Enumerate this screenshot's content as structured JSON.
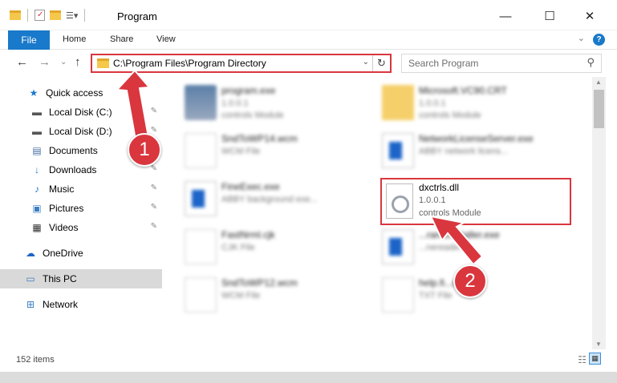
{
  "window": {
    "title": "Program",
    "minimize_glyph": "—",
    "maximize_glyph": "☐",
    "close_glyph": "✕"
  },
  "ribbon": {
    "file": "File",
    "home": "Home",
    "share": "Share",
    "view": "View",
    "help_glyph": "?",
    "collapse_glyph": "⌄"
  },
  "navigation": {
    "back_glyph": "←",
    "forward_glyph": "→",
    "recent_glyph": "⌄",
    "up_glyph": "↑",
    "address_path": "C:\\Program Files\\Program Directory",
    "address_dropdown_glyph": "⌄",
    "refresh_glyph": "↻",
    "search_placeholder": "Search Program",
    "search_glyph": "⚲"
  },
  "sidebar": {
    "items": [
      {
        "label": "Quick access",
        "icon": "star-icon",
        "glyph": "★",
        "color": "#1979ca",
        "pinned": false
      },
      {
        "label": "Local Disk (C:)",
        "icon": "drive-icon",
        "glyph": "▬",
        "color": "#555555",
        "pinned": true
      },
      {
        "label": "Local Disk (D:)",
        "icon": "drive-icon",
        "glyph": "▬",
        "color": "#555555",
        "pinned": true
      },
      {
        "label": "Documents",
        "icon": "documents-icon",
        "glyph": "▤",
        "color": "#4a6fa5",
        "pinned": true
      },
      {
        "label": "Downloads",
        "icon": "download-icon",
        "glyph": "↓",
        "color": "#1979ca",
        "pinned": true
      },
      {
        "label": "Music",
        "icon": "music-icon",
        "glyph": "♪",
        "color": "#1979ca",
        "pinned": true
      },
      {
        "label": "Pictures",
        "icon": "pictures-icon",
        "glyph": "▣",
        "color": "#3a7ec2",
        "pinned": true
      },
      {
        "label": "Videos",
        "icon": "videos-icon",
        "glyph": "▦",
        "color": "#333333",
        "pinned": true
      },
      {
        "label": "OneDrive",
        "icon": "cloud-icon",
        "glyph": "☁",
        "color": "#1c64c8",
        "pinned": false
      },
      {
        "label": "This PC",
        "icon": "computer-icon",
        "glyph": "▭",
        "color": "#3a7ec2",
        "pinned": false
      },
      {
        "label": "Network",
        "icon": "network-icon",
        "glyph": "⊞",
        "color": "#3a7ec2",
        "pinned": false
      }
    ],
    "pin_glyph": "📌"
  },
  "files": [
    {
      "name": "program.exe",
      "sub1": "1.0.0.1",
      "sub2": "controls Module",
      "thumb": "exe"
    },
    {
      "name": "Microsoft.VC90.CRT",
      "sub1": "1.0.0.1",
      "sub2": "controls Module",
      "thumb": "folder"
    },
    {
      "name": "SndToWP14.wcm",
      "sub1": "WCM File",
      "sub2": "",
      "thumb": "doc"
    },
    {
      "name": "NetworkLicenseServer.exe",
      "sub1": "ABBY network licens...",
      "sub2": "",
      "thumb": "app"
    },
    {
      "name": "FineExec.exe",
      "sub1": "ABBY background exe...",
      "sub2": "",
      "thumb": "app"
    },
    {
      "name": "FastNrml.cjk",
      "sub1": "CJK File",
      "sub2": "",
      "thumb": "doc"
    },
    {
      "name": "...ramsInstaller.exe",
      "sub1": "...nereader tri...",
      "sub2": "",
      "thumb": "app"
    },
    {
      "name": "SndToWP12.wcm",
      "sub1": "WCM File",
      "sub2": "",
      "thumb": "doc"
    },
    {
      "name": "help.fi...der.txt",
      "sub1": "TXT File",
      "sub2": "",
      "thumb": "doc"
    }
  ],
  "highlighted_file": {
    "name": "dxctrls.dll",
    "version": "1.0.0.1",
    "description": "controls Module"
  },
  "status": {
    "item_count": "152 items",
    "details_view_glyph": "☷",
    "large_icons_glyph": "▦"
  },
  "callouts": {
    "one": "1",
    "two": "2"
  },
  "colors": {
    "accent": "#1979ca",
    "highlight_red": "#d9363e"
  }
}
